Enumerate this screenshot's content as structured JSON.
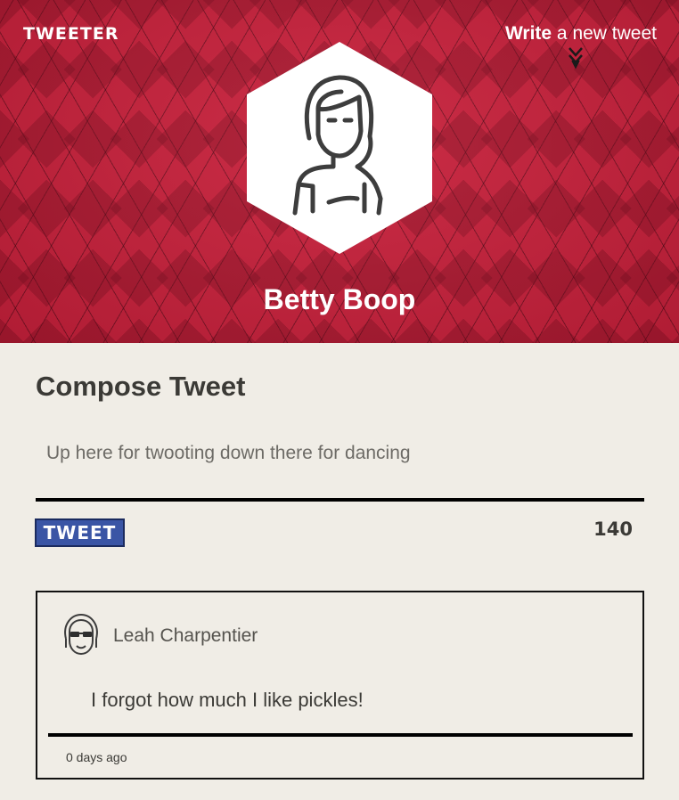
{
  "nav": {
    "logo": "TWEETER",
    "compose_bold": "Write",
    "compose_rest": " a new tweet",
    "compose_icon": "chevron-down-double-icon"
  },
  "profile": {
    "name": "Betty Boop",
    "avatar_icon": "woman-avatar-icon"
  },
  "compose": {
    "title": "Compose Tweet",
    "placeholder": "Up here for twooting down there for dancing",
    "value": "",
    "button_label": "TWEET",
    "counter": "140"
  },
  "tweets": [
    {
      "author": "Leah Charpentier",
      "avatar_icon": "sunglasses-avatar-icon",
      "text": "I forgot how much I like pickles!",
      "time": "0 days ago"
    }
  ],
  "colors": {
    "header_red": "#c8203b",
    "background": "#f0ede6",
    "button_blue": "#3a55a5",
    "text_dark": "#3b3a36"
  }
}
